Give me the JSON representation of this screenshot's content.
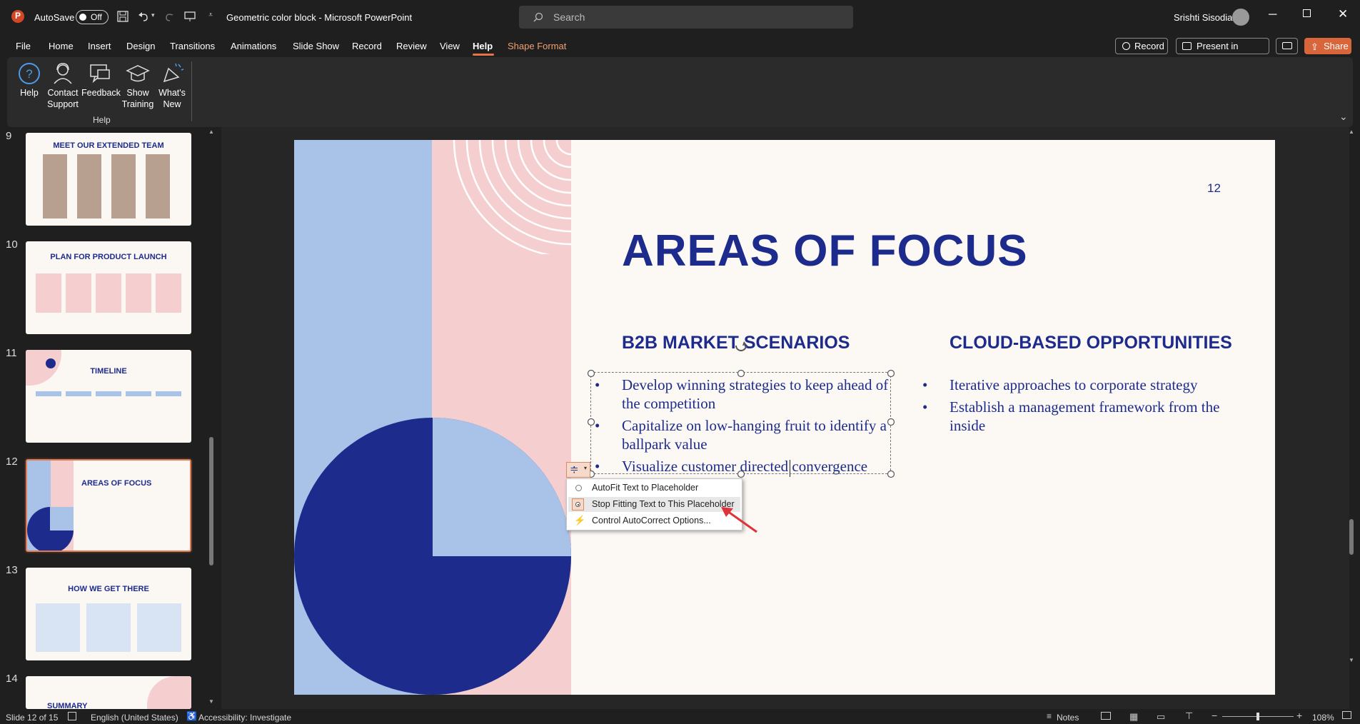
{
  "app": {
    "title": "Geometric color block  -  Microsoft PowerPoint",
    "autosave_label": "AutoSave",
    "autosave_state": "Off",
    "search_placeholder": "Search",
    "user_name": "Srishti Sisodia"
  },
  "menu": {
    "items": [
      "File",
      "Home",
      "Insert",
      "Design",
      "Transitions",
      "Animations",
      "Slide Show",
      "Record",
      "Review",
      "View",
      "Help",
      "Shape Format"
    ],
    "active": "Help",
    "record_btn": "Record",
    "present_btn": "Present in Teams",
    "share_btn": "Share"
  },
  "ribbon": {
    "buttons": [
      {
        "label": "Help",
        "icon": "help-icon"
      },
      {
        "label": "Contact Support",
        "icon": "contact-support-icon"
      },
      {
        "label": "Feedback",
        "icon": "feedback-icon"
      },
      {
        "label": "Show Training",
        "icon": "training-icon"
      },
      {
        "label": "What's New",
        "icon": "whats-new-icon"
      }
    ],
    "group_label": "Help"
  },
  "thumbnails": [
    {
      "num": "9",
      "title": "MEET OUR EXTENDED TEAM"
    },
    {
      "num": "10",
      "title": "PLAN FOR PRODUCT LAUNCH"
    },
    {
      "num": "11",
      "title": "TIMELINE"
    },
    {
      "num": "12",
      "title": "AREAS OF FOCUS"
    },
    {
      "num": "13",
      "title": "HOW WE GET THERE"
    },
    {
      "num": "14",
      "title": "SUMMARY"
    }
  ],
  "slide": {
    "page_number": "12",
    "title": "AREAS OF FOCUS",
    "left_heading": "B2B MARKET SCENARIOS",
    "left_bullets": [
      "Develop winning strategies to keep ahead of the competition",
      "Capitalize on low-hanging fruit to identify a ballpark value",
      "Visualize customer directed convergence"
    ],
    "right_heading": "CLOUD-BASED OPPORTUNITIES",
    "right_bullets": [
      "Iterative approaches to corporate strategy",
      "Establish a management framework from the inside"
    ],
    "colors": {
      "navy": "#1d2b8c",
      "light_blue": "#a9c3e8",
      "pink": "#f5cfd0",
      "cream": "#fcf9f5"
    }
  },
  "autofit_menu": {
    "items": [
      "AutoFit Text to Placeholder",
      "Stop Fitting Text to This Placeholder",
      "Control AutoCorrect Options..."
    ],
    "selected": 1
  },
  "status": {
    "slide": "Slide 12 of 15",
    "language": "English (United States)",
    "accessibility": "Accessibility: Investigate",
    "notes": "Notes",
    "zoom": "108%"
  }
}
